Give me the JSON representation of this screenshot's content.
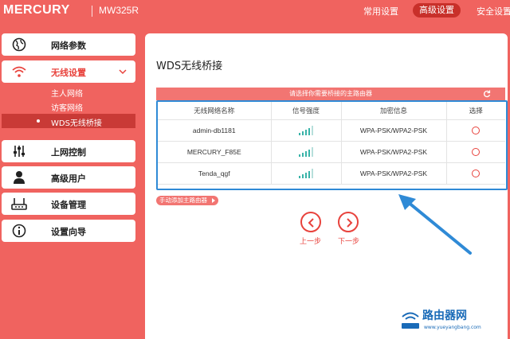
{
  "header": {
    "brand": "MERCURY",
    "model": "MW325R",
    "nav": {
      "basic": "常用设置",
      "advanced": "高级设置",
      "security": "安全设置"
    }
  },
  "sidebar": {
    "items": [
      {
        "label": "网络参数",
        "icon": "globe-icon"
      },
      {
        "label": "无线设置",
        "icon": "wifi-icon"
      },
      {
        "label": "上网控制",
        "icon": "sliders-icon"
      },
      {
        "label": "高级用户",
        "icon": "user-icon"
      },
      {
        "label": "设备管理",
        "icon": "router-icon"
      },
      {
        "label": "设置向导",
        "icon": "info-icon"
      }
    ],
    "wireless_sub": [
      "主人网络",
      "访客网络",
      "WDS无线桥接"
    ]
  },
  "main": {
    "title": "WDS无线桥接",
    "bar_text": "请选择你需要桥接的主路由器",
    "columns": [
      "无线网络名称",
      "信号强度",
      "加密信息",
      "选择"
    ],
    "rows": [
      {
        "ssid": "admin-db1181",
        "signal": 4,
        "security": "WPA-PSK/WPA2-PSK"
      },
      {
        "ssid": "MERCURY_F85E",
        "signal": 4,
        "security": "WPA-PSK/WPA2-PSK"
      },
      {
        "ssid": "Tenda_qgf",
        "signal": 4,
        "security": "WPA-PSK/WPA2-PSK"
      }
    ],
    "add_router": "手动添加主路由器",
    "prev": "上一步",
    "next": "下一步"
  },
  "watermark": {
    "name": "路由器网",
    "url": "www.yueyangbang.com"
  },
  "colors": {
    "brand_red": "#f0635f",
    "dark_red": "#c8302a",
    "accent_red": "#e8423c",
    "highlight_blue": "#2f8ad6",
    "signal_teal": "#38b3a8"
  }
}
